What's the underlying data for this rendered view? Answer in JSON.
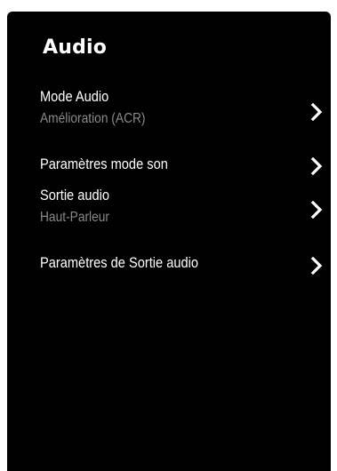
{
  "menu": {
    "title": "Audio",
    "items": [
      {
        "label": "Mode Audio",
        "value": "Amélioration (ACR)",
        "icon": "chevron-right-icon"
      },
      {
        "label": "Paramètres mode son",
        "icon": "chevron-right-icon"
      },
      {
        "label": "Sortie audio",
        "value": "Haut-Parleur",
        "icon": "chevron-right-icon"
      },
      {
        "label": "Paramètres de Sortie audio",
        "icon": "chevron-right-icon"
      }
    ]
  },
  "colors": {
    "background": "#000000",
    "text": "#ffffff",
    "secondary_text": "#8a8a8a"
  }
}
